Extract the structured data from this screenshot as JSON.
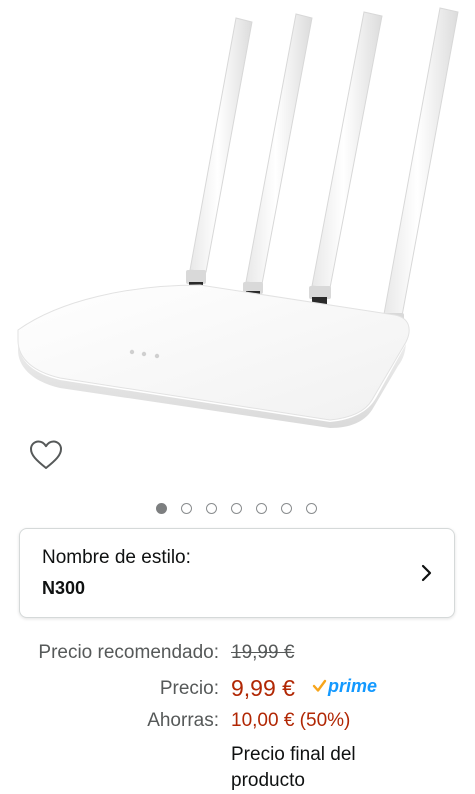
{
  "product": {
    "image_alt": "router",
    "carousel": {
      "count": 7,
      "active_index": 0
    }
  },
  "style": {
    "label": "Nombre de estilo:",
    "value": "N300"
  },
  "pricing": {
    "list_price_label": "Precio recomendado:",
    "list_price": "19,99 €",
    "price_label": "Precio:",
    "price": "9,99 €",
    "prime_label": "prime",
    "savings_label": "Ahorras:",
    "savings": "10,00 € (50%)",
    "final_note": "Precio final del producto"
  },
  "colors": {
    "price_red": "#b12704",
    "prime_blue": "#1399ff",
    "prime_check_orange": "#f7a51c",
    "border": "#d5d9d9"
  },
  "icons": {
    "wishlist": "heart-outline-icon",
    "style_chevron": "chevron-right-icon",
    "prime_check": "prime-check-icon"
  }
}
